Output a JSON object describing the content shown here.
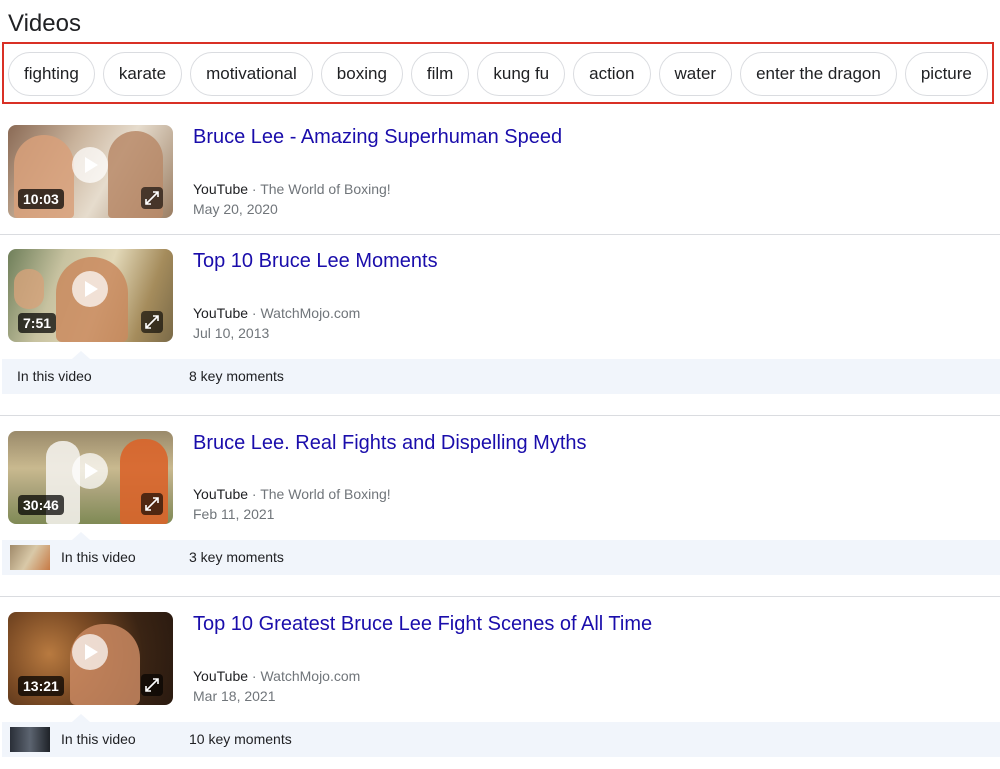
{
  "section": {
    "title": "Videos"
  },
  "chips": [
    "fighting",
    "karate",
    "motivational",
    "boxing",
    "film",
    "kung fu",
    "action",
    "water",
    "enter the dragon",
    "picture"
  ],
  "videos": [
    {
      "title": "Bruce Lee - Amazing Superhuman Speed",
      "source": "YouTube",
      "separator": "·",
      "channel": "The World of Boxing!",
      "date": "May 20, 2020",
      "duration": "10:03"
    },
    {
      "title": "Top 10 Bruce Lee Moments",
      "source": "YouTube",
      "separator": "·",
      "channel": "WatchMojo.com",
      "date": "Jul 10, 2013",
      "duration": "7:51",
      "key_moments": {
        "label": "In this video",
        "count": "8 key moments"
      }
    },
    {
      "title": "Bruce Lee. Real Fights and Dispelling Myths",
      "source": "YouTube",
      "separator": "·",
      "channel": "The World of Boxing!",
      "date": "Feb 11, 2021",
      "duration": "30:46",
      "key_moments": {
        "label": "In this video",
        "count": "3 key moments"
      }
    },
    {
      "title": "Top 10 Greatest Bruce Lee Fight Scenes of All Time",
      "source": "YouTube",
      "separator": "·",
      "channel": "WatchMojo.com",
      "date": "Mar 18, 2021",
      "duration": "13:21",
      "key_moments": {
        "label": "In this video",
        "count": "10 key moments"
      }
    }
  ],
  "icons": {
    "play": "play-icon",
    "expand": "expand-icon"
  },
  "colors": {
    "link": "#1a0dab",
    "highlight_border": "#d93025",
    "key_moments_bg": "#f1f5fb",
    "divider": "#dadce0"
  }
}
